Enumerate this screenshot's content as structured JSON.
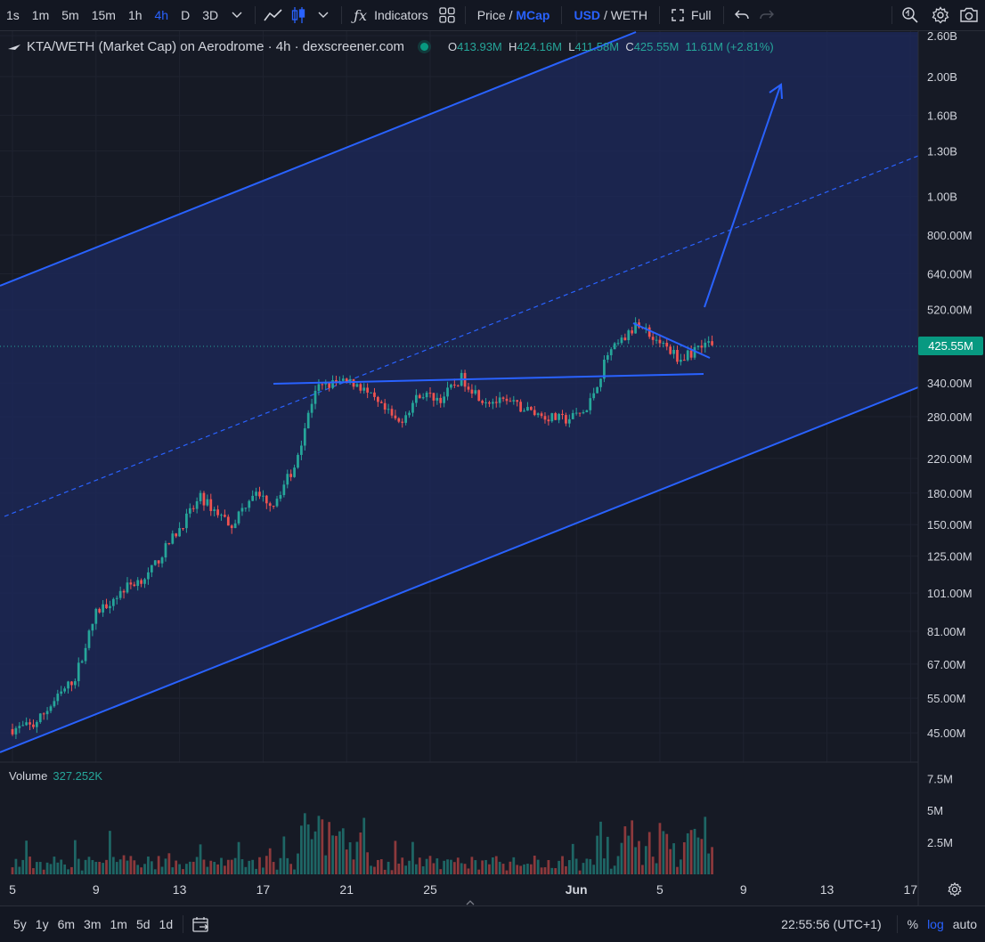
{
  "toolbar": {
    "timeframes": [
      "1s",
      "1m",
      "5m",
      "15m",
      "1h",
      "4h",
      "D",
      "3D"
    ],
    "active_timeframe": "4h",
    "indicators_label": "Indicators",
    "price_label": "Price /",
    "mcap_label": "MCap",
    "usd_label": "USD",
    "weth_label": "/ WETH",
    "full_label": "Full"
  },
  "legend": {
    "title": "KTA/WETH (Market Cap) on Aerodrome · 4h · dexscreener.com",
    "o_label": "O",
    "o_value": "413.93M",
    "h_label": "H",
    "h_value": "424.16M",
    "l_label": "L",
    "l_value": "411.58M",
    "c_label": "C",
    "c_value": "425.55M",
    "change": "11.61M (+2.81%)"
  },
  "current_price": "425.55M",
  "volume": {
    "label": "Volume",
    "value": "327.252K"
  },
  "colors": {
    "up": "#26a69a",
    "down": "#ef5350",
    "accent": "#2962ff",
    "background": "#161a25",
    "channel": "#1e2a5c"
  },
  "bottom": {
    "ranges": [
      "5y",
      "1y",
      "6m",
      "3m",
      "1m",
      "5d",
      "1d"
    ],
    "time": "22:55:56 (UTC+1)",
    "percent": "%",
    "log": "log",
    "auto": "auto"
  },
  "chart_data": {
    "type": "candlestick",
    "price_axis_scale": "log",
    "price_ticks": [
      "2.60B",
      "2.00B",
      "1.60B",
      "1.30B",
      "1.00B",
      "800.00M",
      "640.00M",
      "520.00M",
      "340.00M",
      "280.00M",
      "220.00M",
      "180.00M",
      "150.00M",
      "125.00M",
      "101.00M",
      "81.00M",
      "67.00M",
      "55.00M",
      "45.00M"
    ],
    "volume_ticks": [
      "7.5M",
      "5M",
      "2.5M"
    ],
    "time_ticks": [
      "5",
      "9",
      "13",
      "17",
      "21",
      "25",
      "Jun",
      "5",
      "9",
      "13",
      "17"
    ],
    "price_range": [
      38000000,
      2600000000
    ],
    "series_anchors_marketcap": [
      {
        "day": 5.0,
        "close": 46000000
      },
      {
        "day": 6.0,
        "close": 47000000
      },
      {
        "day": 7.0,
        "close": 54000000
      },
      {
        "day": 8.0,
        "close": 62000000
      },
      {
        "day": 9.0,
        "close": 90000000
      },
      {
        "day": 10.5,
        "close": 105000000
      },
      {
        "day": 11.5,
        "close": 112000000
      },
      {
        "day": 12.5,
        "close": 135000000
      },
      {
        "day": 14.0,
        "close": 175000000
      },
      {
        "day": 15.5,
        "close": 150000000
      },
      {
        "day": 16.5,
        "close": 180000000
      },
      {
        "day": 17.5,
        "close": 170000000
      },
      {
        "day": 18.5,
        "close": 210000000
      },
      {
        "day": 19.5,
        "close": 330000000
      },
      {
        "day": 20.5,
        "close": 340000000
      },
      {
        "day": 21.5,
        "close": 340000000
      },
      {
        "day": 22.5,
        "close": 300000000
      },
      {
        "day": 23.5,
        "close": 270000000
      },
      {
        "day": 24.5,
        "close": 320000000
      },
      {
        "day": 25.5,
        "close": 310000000
      },
      {
        "day": 26.5,
        "close": 350000000
      },
      {
        "day": 27.5,
        "close": 310000000
      },
      {
        "day": 29.0,
        "close": 300000000
      },
      {
        "day": 30.5,
        "close": 280000000
      },
      {
        "day": 31.5,
        "close": 275000000
      },
      {
        "day": 32.5,
        "close": 290000000
      },
      {
        "day": 33.5,
        "close": 400000000
      },
      {
        "day": 34.5,
        "close": 450000000
      },
      {
        "day": 35.0,
        "close": 480000000
      },
      {
        "day": 36.0,
        "close": 430000000
      },
      {
        "day": 37.0,
        "close": 390000000
      },
      {
        "day": 37.5,
        "close": 405000000
      },
      {
        "day": 38.0,
        "close": 430000000
      },
      {
        "day": 38.5,
        "close": 425550000
      }
    ]
  }
}
